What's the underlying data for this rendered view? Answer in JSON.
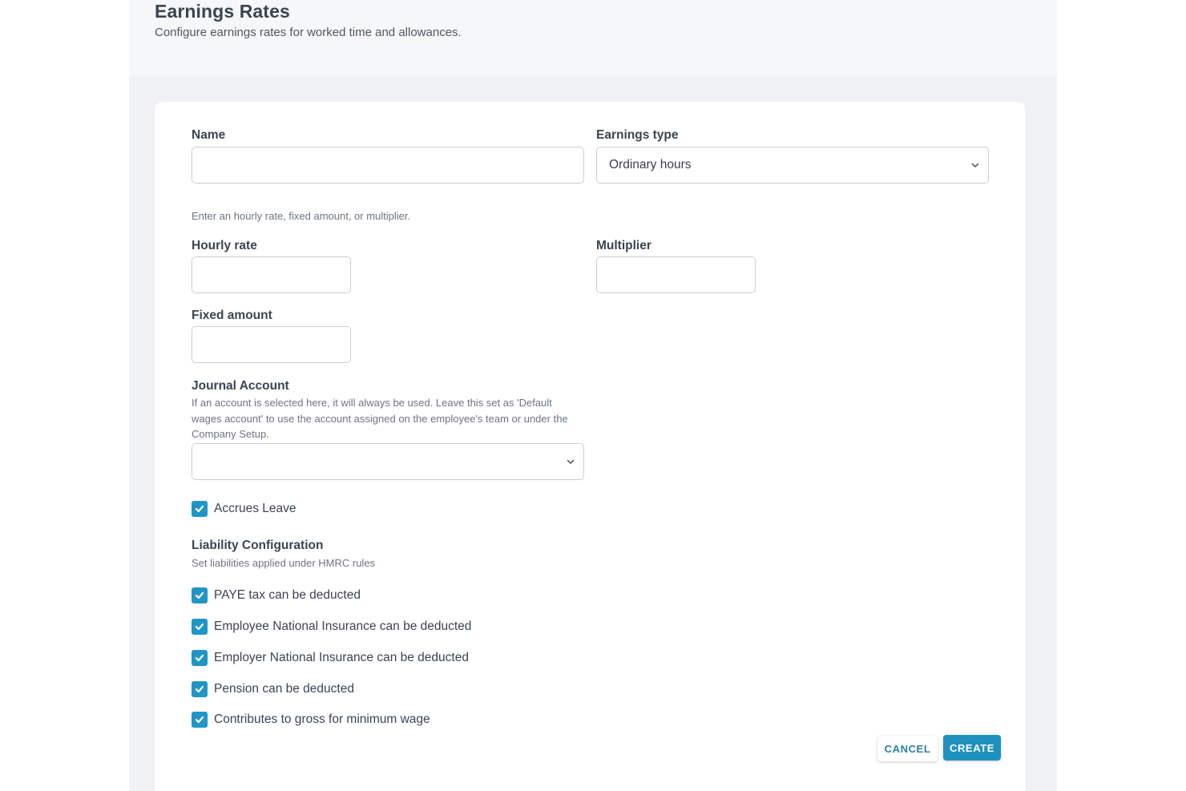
{
  "header": {
    "title": "Earnings Rates",
    "subtitle": "Configure earnings rates for worked time and allowances."
  },
  "form": {
    "name": {
      "label": "Name",
      "value": ""
    },
    "earnings_type": {
      "label": "Earnings type",
      "value": "Ordinary hours",
      "icon": "chevron-down-icon"
    },
    "rate_hint": "Enter an hourly rate, fixed amount, or multiplier.",
    "hourly_rate": {
      "label": "Hourly rate",
      "value": ""
    },
    "multiplier": {
      "label": "Multiplier",
      "value": ""
    },
    "fixed_amount": {
      "label": "Fixed amount",
      "value": ""
    },
    "journal_account": {
      "label": "Journal Account",
      "help_line1": "If an account is selected here, it will always be used. Leave this set as 'Default",
      "help_line2": "wages account' to use the account assigned on the employee's team or under the",
      "help_line3": "Company Setup.",
      "value": ""
    },
    "accrues_leave": {
      "label": "Accrues Leave",
      "checked": true
    },
    "liability": {
      "title": "Liability Configuration",
      "subtitle": "Set liabilities applied under HMRC rules",
      "options": [
        {
          "label": "PAYE tax can be deducted",
          "checked": true
        },
        {
          "label": "Employee National Insurance can be deducted",
          "checked": true
        },
        {
          "label": "Employer National Insurance can be deducted",
          "checked": true
        },
        {
          "label": "Pension can be deducted",
          "checked": true
        },
        {
          "label": "Contributes to gross for minimum wage",
          "checked": true
        }
      ]
    }
  },
  "actions": {
    "cancel_label": "CANCEL",
    "create_label": "CREATE"
  },
  "colors": {
    "accent": "#1f96c6",
    "primary_button": "#1f91bf",
    "background": "#f0f2f4"
  }
}
